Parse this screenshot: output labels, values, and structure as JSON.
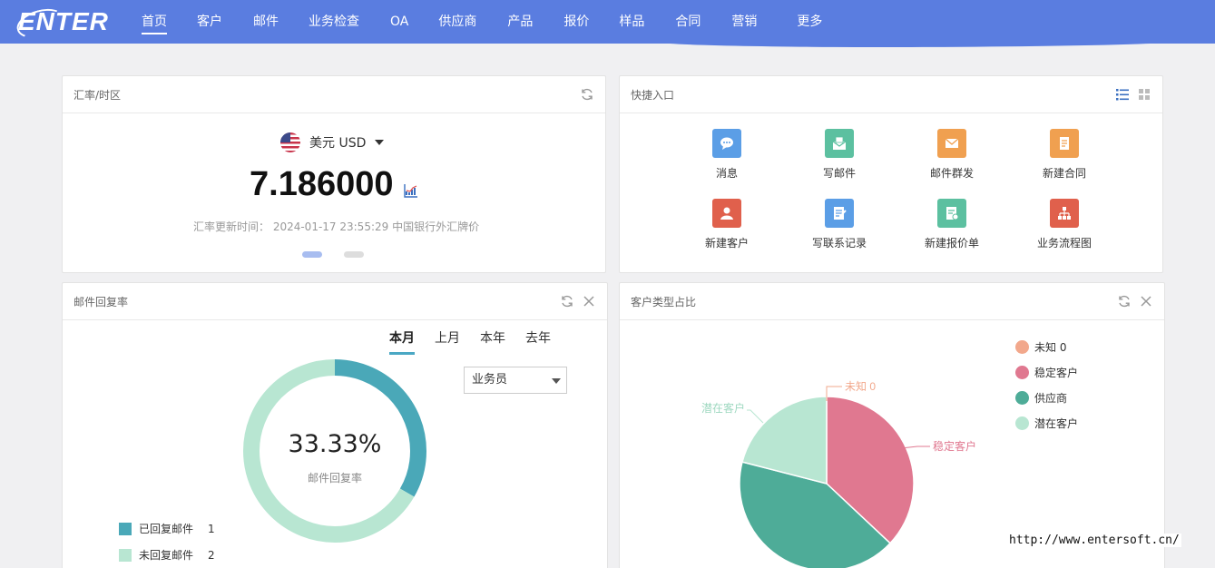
{
  "app": {
    "logo_text": "ENTER"
  },
  "nav": {
    "items": [
      {
        "label": "首页",
        "active": true
      },
      {
        "label": "客户"
      },
      {
        "label": "邮件"
      },
      {
        "label": "业务检查"
      },
      {
        "label": "OA"
      },
      {
        "label": "供应商"
      },
      {
        "label": "产品"
      },
      {
        "label": "报价"
      },
      {
        "label": "样品"
      },
      {
        "label": "合同"
      },
      {
        "label": "营销"
      },
      {
        "label": "更多"
      }
    ]
  },
  "exchange": {
    "title": "汇率/时区",
    "currency": "美元 USD",
    "rate": "7.186000",
    "update_note": "汇率更新时间： 2024-01-17 23:55:29  中国银行外汇牌价"
  },
  "quick": {
    "title": "快捷入口",
    "items": [
      {
        "label": "消息",
        "icon": "chat-icon",
        "color": "#5b9ee6"
      },
      {
        "label": "写邮件",
        "icon": "compose-mail-icon",
        "color": "#5cc0a0"
      },
      {
        "label": "邮件群发",
        "icon": "mass-mail-icon",
        "color": "#f0a050"
      },
      {
        "label": "新建合同",
        "icon": "contract-icon",
        "color": "#f0a050"
      },
      {
        "label": "新建客户",
        "icon": "customer-icon",
        "color": "#e0604c"
      },
      {
        "label": "写联系记录",
        "icon": "note-icon",
        "color": "#5b9ee6"
      },
      {
        "label": "新建报价单",
        "icon": "quote-icon",
        "color": "#5cc0a0"
      },
      {
        "label": "业务流程图",
        "icon": "flowchart-icon",
        "color": "#e0604c"
      }
    ]
  },
  "mail_reply": {
    "title": "邮件回复率",
    "tabs": [
      "本月",
      "上月",
      "本年",
      "去年"
    ],
    "active_tab": 0,
    "select_value": "业务员",
    "percent": "33.33%",
    "center_label": "邮件回复率",
    "legend": [
      {
        "label": "已回复邮件",
        "count": "1",
        "color": "#4aa8b8"
      },
      {
        "label": "未回复邮件",
        "count": "2",
        "color": "#b8e6d2"
      }
    ]
  },
  "customer_type": {
    "title": "客户类型占比",
    "legend": [
      {
        "label": "未知 0",
        "color": "#f2a88c"
      },
      {
        "label": "稳定客户",
        "color": "#e07890"
      },
      {
        "label": "供应商",
        "color": "#4eac98"
      },
      {
        "label": "潜在客户",
        "color": "#b8e6d2"
      }
    ],
    "callouts": {
      "unknown": "未知 0",
      "stable": "稳定客户",
      "potential": "潜在客户"
    }
  },
  "chart_data": [
    {
      "type": "pie",
      "title": "邮件回复率",
      "categories": [
        "已回复邮件",
        "未回复邮件"
      ],
      "values": [
        1,
        2
      ],
      "colors": [
        "#4aa8b8",
        "#b8e6d2"
      ]
    },
    {
      "type": "pie",
      "title": "客户类型占比",
      "categories": [
        "未知",
        "稳定客户",
        "供应商",
        "潜在客户"
      ],
      "values": [
        0,
        37,
        42,
        21
      ],
      "colors": [
        "#f2a88c",
        "#e07890",
        "#4eac98",
        "#b8e6d2"
      ]
    }
  ],
  "watermark": "http://www.entersoft.cn/"
}
